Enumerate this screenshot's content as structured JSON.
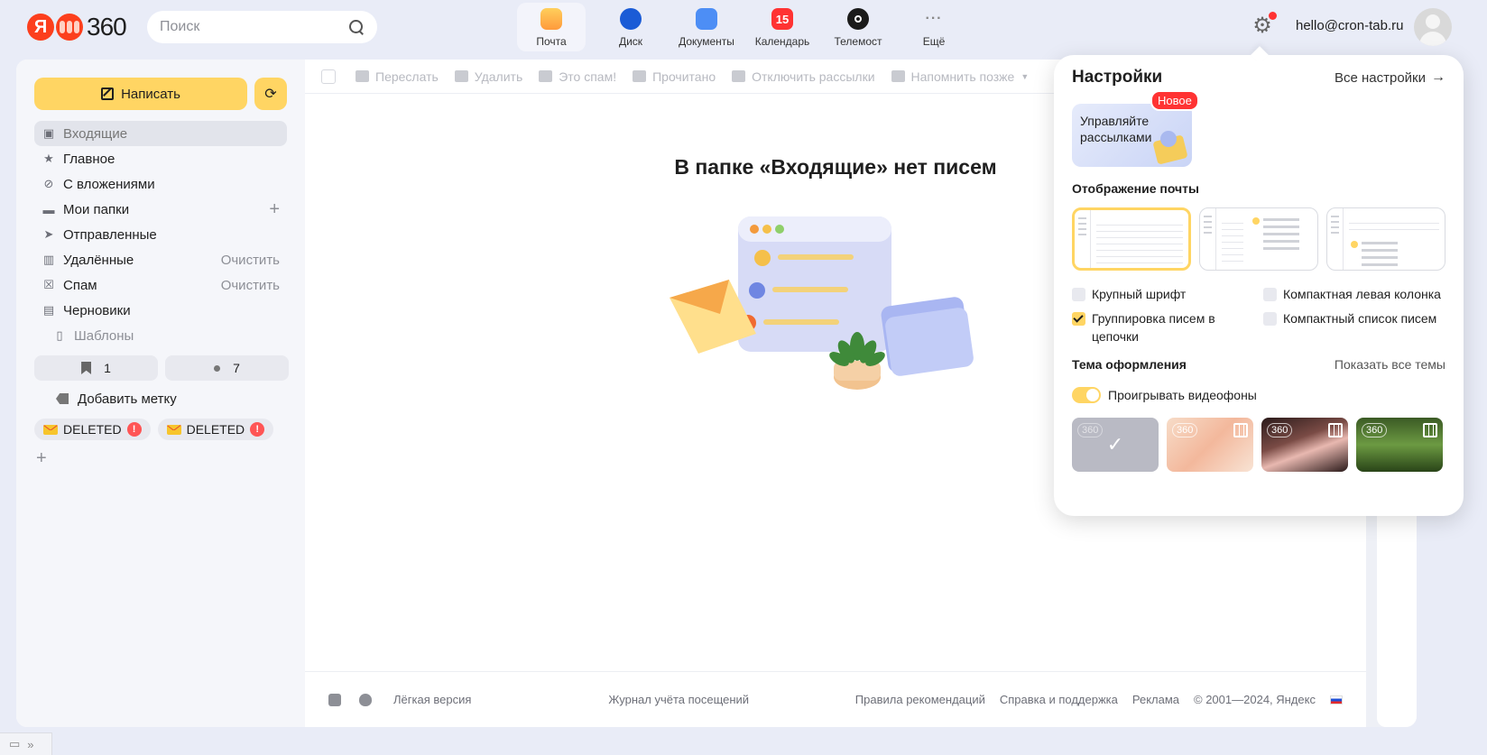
{
  "header": {
    "logo_text": "360",
    "search_placeholder": "Поиск",
    "apps": [
      {
        "label": "Почта",
        "icon": "mail-icon"
      },
      {
        "label": "Диск",
        "icon": "disk-icon"
      },
      {
        "label": "Документы",
        "icon": "docs-icon"
      },
      {
        "label": "Календарь",
        "icon": "calendar-icon",
        "badge": "15"
      },
      {
        "label": "Телемост",
        "icon": "telemost-icon"
      },
      {
        "label": "Ещё",
        "icon": "more-icon"
      }
    ],
    "user_email": "hello@cron-tab.ru"
  },
  "sidebar": {
    "compose_label": "Написать",
    "folders": [
      {
        "label": "Входящие",
        "icon": "inbox-icon"
      },
      {
        "label": "Главное",
        "icon": "star-icon"
      },
      {
        "label": "С вложениями",
        "icon": "paperclip-icon"
      },
      {
        "label": "Мои папки",
        "icon": "folder-icon",
        "action": "+"
      },
      {
        "label": "Отправленные",
        "icon": "send-icon"
      },
      {
        "label": "Удалённые",
        "icon": "trash-icon",
        "action": "Очистить"
      },
      {
        "label": "Спам",
        "icon": "spam-icon",
        "action": "Очистить"
      },
      {
        "label": "Черновики",
        "icon": "drafts-icon"
      },
      {
        "label": "Шаблоны",
        "icon": "template-icon"
      }
    ],
    "bookmark_count": "1",
    "unread_count": "7",
    "add_label": "Добавить метку",
    "tags": [
      {
        "label": "DELETED",
        "warn": "!"
      },
      {
        "label": "DELETED",
        "warn": "!"
      }
    ]
  },
  "toolbar": {
    "items": [
      "Переслать",
      "Удалить",
      "Это спам!",
      "Прочитано",
      "Отключить рассылки",
      "Напомнить позже"
    ]
  },
  "main": {
    "empty_title": "В папке «Входящие» нет писем"
  },
  "footer": {
    "light_version": "Лёгкая версия",
    "visit_log": "Журнал учёта посещений",
    "rules": "Правила рекомендаций",
    "help": "Справка и поддержка",
    "ads": "Реклама",
    "copyright": "© 2001—2024, Яндекс"
  },
  "settings": {
    "title": "Настройки",
    "all_settings": "Все настройки",
    "promo_text": "Управляйте рассылками",
    "promo_badge": "Новое",
    "mail_display_title": "Отображение почты",
    "options": {
      "large_font": "Крупный шрифт",
      "compact_left": "Компактная левая колонка",
      "grouping": "Группировка писем в цепочки",
      "compact_list": "Компактный список писем"
    },
    "theme_title": "Тема оформления",
    "show_all_themes": "Показать все темы",
    "video_bg": "Проигрывать видеофоны",
    "theme_mark": "360"
  },
  "colors": {
    "accent": "#ffd563",
    "danger": "#ff3333"
  }
}
